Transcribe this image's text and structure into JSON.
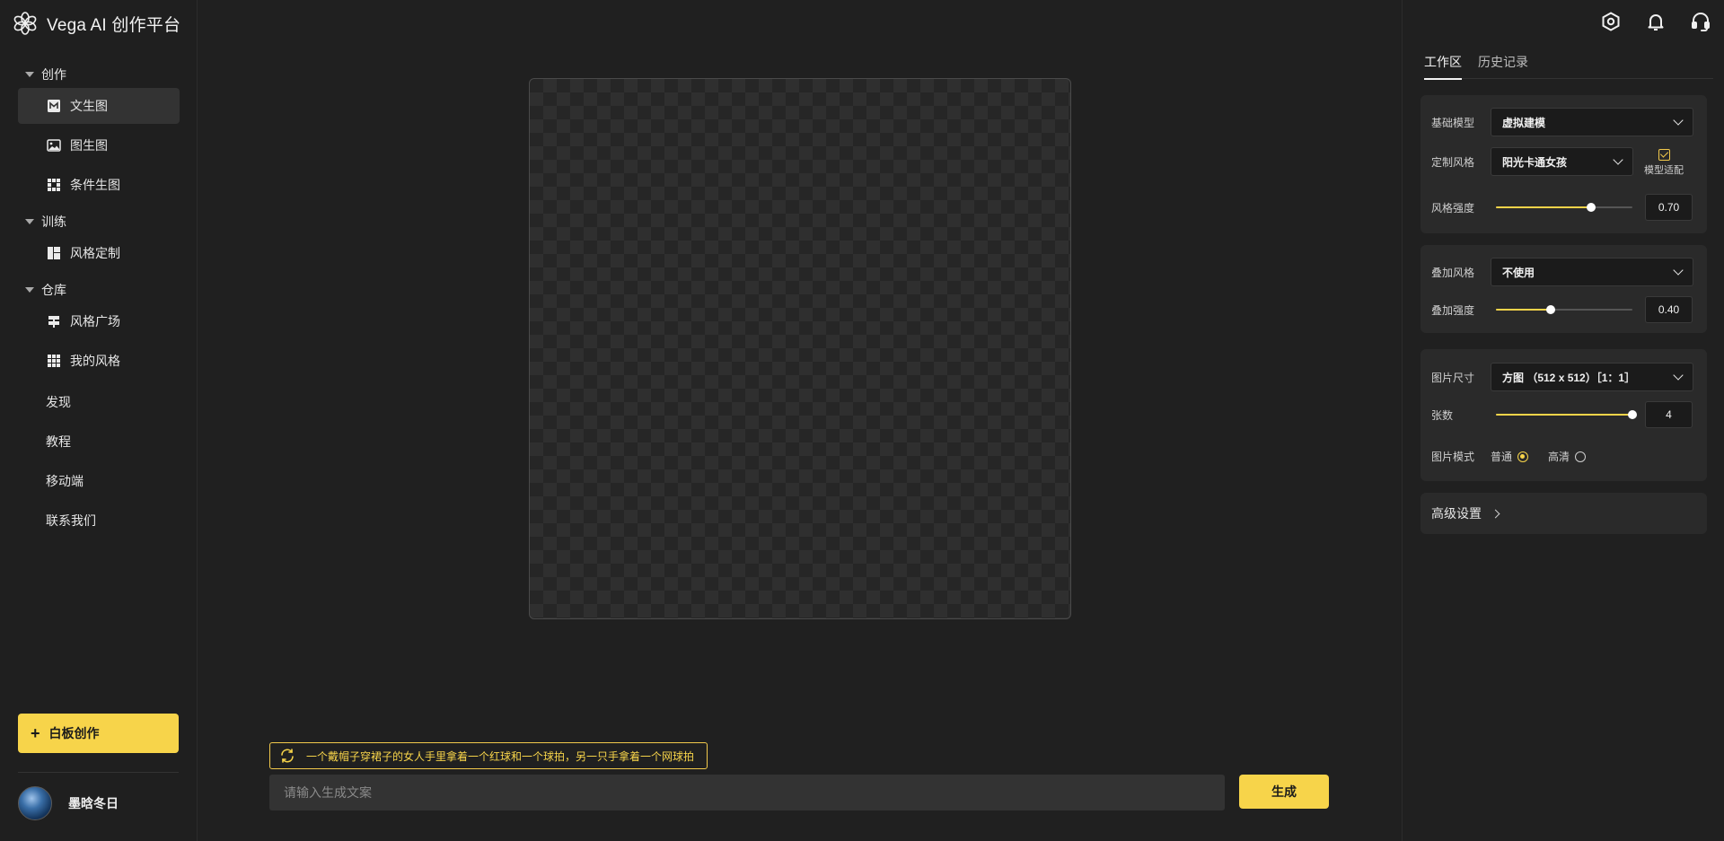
{
  "app": {
    "title": "Vega AI 创作平台"
  },
  "sidebar": {
    "groups": [
      {
        "label": "创作",
        "items": [
          {
            "label": "文生图",
            "icon": "text-to-image-icon",
            "active": true
          },
          {
            "label": "图生图",
            "icon": "image-icon"
          },
          {
            "label": "条件生图",
            "icon": "grid-icon"
          }
        ]
      },
      {
        "label": "训练",
        "items": [
          {
            "label": "风格定制",
            "icon": "layout-icon"
          }
        ]
      },
      {
        "label": "仓库",
        "items": [
          {
            "label": "风格广场",
            "icon": "signpost-icon"
          },
          {
            "label": "我的风格",
            "icon": "apps-icon"
          }
        ]
      }
    ],
    "links": [
      "发现",
      "教程",
      "移动端",
      "联系我们"
    ],
    "whiteboard_label": "白板创作",
    "user": {
      "name": "墨晗冬日"
    }
  },
  "main": {
    "suggestion": "一个戴帽子穿裙子的女人手里拿着一个红球和一个球拍，另一只手拿着一个网球拍",
    "prompt_placeholder": "请输入生成文案",
    "generate_label": "生成"
  },
  "right": {
    "tabs": [
      {
        "label": "工作区",
        "active": true
      },
      {
        "label": "历史记录"
      }
    ],
    "base_model": {
      "label": "基础模型",
      "value": "虚拟建模"
    },
    "custom_style": {
      "label": "定制风格",
      "value": "阳光卡通女孩",
      "fit_label": "模型适配",
      "fit_checked": true
    },
    "style_strength": {
      "label": "风格强度",
      "value": "0.70",
      "fraction": 0.7
    },
    "overlay_style": {
      "label": "叠加风格",
      "value": "不使用"
    },
    "overlay_strength": {
      "label": "叠加强度",
      "value": "0.40",
      "fraction": 0.4
    },
    "image_size": {
      "label": "图片尺寸",
      "value": "方图 （512 x 512）［1：1］"
    },
    "count": {
      "label": "张数",
      "value": "4",
      "fraction": 1.0
    },
    "image_mode": {
      "label": "图片模式",
      "options": [
        {
          "label": "普通",
          "selected": true
        },
        {
          "label": "高清",
          "selected": false
        }
      ]
    },
    "advanced_label": "高级设置"
  },
  "colors": {
    "accent": "#f7d44a",
    "background": "#202020",
    "panel": "#2a2a2a",
    "input": "#333333"
  }
}
